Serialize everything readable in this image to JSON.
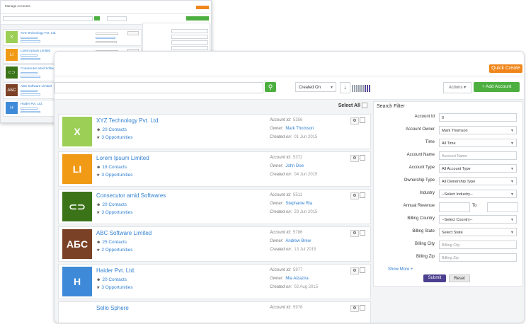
{
  "colors": {
    "accent_green": "#4caf3f",
    "quick_create": "#f0861b",
    "submit": "#4b3f8f",
    "link": "#2f7fd1"
  },
  "header": {
    "quick_create_label": "Quick Create"
  },
  "toolbar": {
    "sort_value": "Created On",
    "sort_direction": "↓",
    "actions_label": "Actions",
    "add_account_label": "+ Add Account",
    "search_icon": "search-icon"
  },
  "list": {
    "select_all_label": "Select All",
    "accounts": [
      {
        "name": "XYZ Technology Pvt. Ltd.",
        "contacts": "20 Contacts",
        "opportunities": "3 Opportunities",
        "account_id": "5356",
        "owner": "Mark Thomson",
        "created_on": "01 Jun 2015",
        "logo_text": "X",
        "logo_color": "#9bcf55"
      },
      {
        "name": "Lorem Ipsum Limited",
        "contacts": "18 Contacts",
        "opportunities": "3 Opportunities",
        "account_id": "5372",
        "owner": "John Doe",
        "created_on": "04 Jun 2015",
        "logo_text": "LI",
        "logo_color": "#f09a16"
      },
      {
        "name": "Consecutor amid Softwares",
        "contacts": "20 Contacts",
        "opportunities": "3 Opportunities",
        "account_id": "5511",
        "owner": "Stephanie Ria",
        "created_on": "29 Jun 2015",
        "logo_text": "⊂⊃",
        "logo_color": "#3b7418"
      },
      {
        "name": "ABC Software Limited",
        "contacts": "25 Contacts",
        "opportunities": "2 Opportunities",
        "account_id": "5786",
        "owner": "Andrew Brew",
        "created_on": "13 Jul 2015",
        "logo_text": "ΑƂC",
        "logo_color": "#7b4126"
      },
      {
        "name": "Haider Pvt. Ltd.",
        "contacts": "20 Contacts",
        "opportunities": "3 Opportunities",
        "account_id": "5977",
        "owner": "Mia Alzazira",
        "created_on": "02 Aug 2015",
        "logo_text": "H",
        "logo_color": "#3e8ad9"
      },
      {
        "name": "Sello Sphere",
        "contacts": "",
        "opportunities": "",
        "account_id": "5978",
        "owner": "",
        "created_on": "",
        "logo_text": "",
        "logo_color": "#ffffff"
      }
    ],
    "labels": {
      "account_id": "Account Id:",
      "owner": "Owner:",
      "created_on": "Created on:"
    }
  },
  "filter": {
    "title": "Search Filter",
    "fields": [
      {
        "label": "Account Id",
        "value": "0",
        "placeholder": ""
      },
      {
        "label": "Account Owner",
        "value": "Mark Thomson",
        "placeholder": "",
        "select": true
      },
      {
        "label": "Time",
        "value": "All Time",
        "placeholder": "",
        "select": true
      },
      {
        "label": "Account Name",
        "value": "",
        "placeholder": "Account Name"
      },
      {
        "label": "Account Type",
        "value": "All Account Type",
        "placeholder": "",
        "select": true
      },
      {
        "label": "Ownership Type",
        "value": "All Ownership Type",
        "placeholder": "",
        "select": true
      },
      {
        "label": "Industry",
        "value": "--Select Industry--",
        "placeholder": "",
        "select": true
      },
      {
        "label": "Annual Revenue",
        "value": "",
        "placeholder": "",
        "range": true,
        "to_label": "To"
      },
      {
        "label": "Billing Country",
        "value": "--Select Country--",
        "placeholder": "",
        "select": true
      },
      {
        "label": "Billing State",
        "value": "Select State",
        "placeholder": "",
        "select": true
      },
      {
        "label": "Billing City",
        "value": "",
        "placeholder": "Billing City"
      },
      {
        "label": "Billing Zip",
        "value": "",
        "placeholder": "Billing Zip"
      }
    ],
    "show_more_label": "Show More +",
    "submit_label": "Submit",
    "reset_label": "Reset"
  },
  "small_window": {
    "title": "Manage Accounts",
    "accounts": [
      {
        "name": "XYZ Technology Pvt. Ltd.",
        "logo_color": "#9bcf55",
        "logo_text": "X"
      },
      {
        "name": "Lorem Ipsum Limited",
        "logo_color": "#f09a16",
        "logo_text": "LI"
      },
      {
        "name": "Consecutor amid Softwares",
        "logo_color": "#3b7418",
        "logo_text": "⊂⊃"
      },
      {
        "name": "ABC Software Limited",
        "logo_color": "#7b4126",
        "logo_text": "ΑƂC"
      },
      {
        "name": "Haider Pvt. Ltd.",
        "logo_color": "#3e8ad9",
        "logo_text": "H"
      }
    ]
  }
}
